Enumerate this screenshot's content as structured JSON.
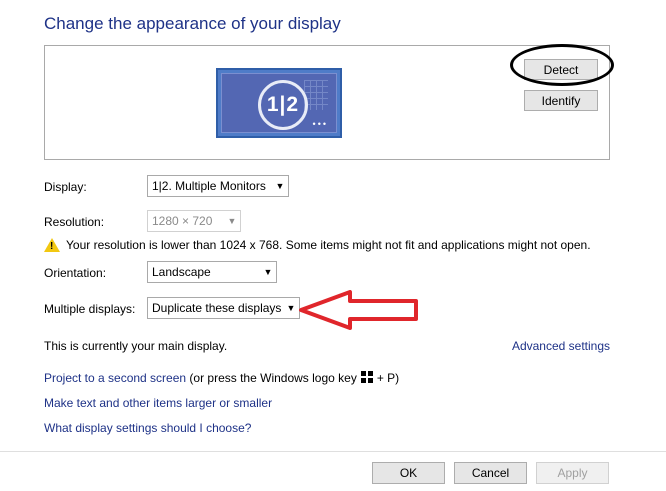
{
  "title": "Change the appearance of your display",
  "preview": {
    "monitor_label": "1|2",
    "dots": "•••",
    "detect_label": "Detect",
    "identify_label": "Identify"
  },
  "display": {
    "label": "Display:",
    "value": "1|2. Multiple Monitors"
  },
  "resolution": {
    "label": "Resolution:",
    "value": "1280 × 720"
  },
  "warning": {
    "text": "Your resolution is lower than 1024 x 768. Some items might not fit and applications might not open."
  },
  "orientation": {
    "label": "Orientation:",
    "value": "Landscape"
  },
  "multiple_displays": {
    "label": "Multiple displays:",
    "value": "Duplicate these displays"
  },
  "main_display_text": "This is currently your main display.",
  "advanced_settings": "Advanced settings",
  "links": {
    "project": "Project to a second screen",
    "project_suffix_pre": "(or press the Windows logo key",
    "project_suffix_post": "+ P)",
    "text_size": "Make text and other items larger or smaller",
    "which_settings": "What display settings should I choose?"
  },
  "buttons": {
    "ok": "OK",
    "cancel": "Cancel",
    "apply": "Apply"
  },
  "colors": {
    "link": "#1e3287",
    "annotation_arrow": "#e0262b",
    "annotation_ellipse": "#000000",
    "monitor": "#4f7cc8"
  }
}
